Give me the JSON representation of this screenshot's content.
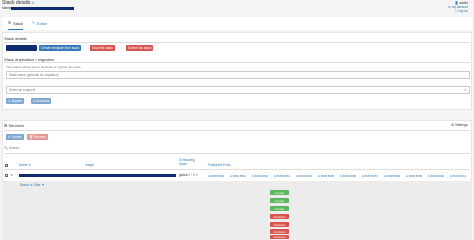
{
  "header": {
    "title": "Stack details",
    "name_label": "Name:",
    "user": "admin",
    "links": [
      "my account",
      "log out"
    ]
  },
  "tabs": [
    {
      "label": "Stack",
      "icon": "list-icon",
      "active": true
    },
    {
      "label": "Editor",
      "icon": "edit-icon",
      "active": false
    }
  ],
  "stack_details": {
    "heading": "Stack details",
    "buttons": {
      "create_template": "Create template from stack",
      "stop": "Stop this stack",
      "delete": "Delete this stack"
    }
  },
  "duplication": {
    "heading": "Stack duplication / migration",
    "description": "This feature allows you to duplicate or migrate this stack.",
    "name_placeholder": "Stack name (optional for migration)",
    "endpoint_placeholder": "Select an endpoint",
    "migrate_label": "Migrate",
    "duplicate_label": "Duplicate"
  },
  "services": {
    "heading": "Services",
    "settings_label": "Settings",
    "update_label": "Update",
    "remove_label": "Remove",
    "search_placeholder": "Search...",
    "columns": {
      "name": "Name",
      "image": "Image",
      "scheduling": "Scheduling Mode",
      "ports": "Published Ports"
    },
    "row": {
      "mode": "global",
      "count": "3 / 5",
      "ports": [
        "8080:8080",
        "8081:8081",
        "8082:8082",
        "8083:8083",
        "8084:8084",
        "8085:8085",
        "8086:8086",
        "8087:8087",
        "8088:8088",
        "8089:8089",
        "8090:8090",
        "8091:8091"
      ]
    },
    "tasks": {
      "status_label": "Status",
      "filter_label": "Filter",
      "statuses": [
        "running",
        "running",
        "running",
        "shutdown",
        "shutdown",
        "shutdown",
        "shutdown"
      ]
    }
  },
  "colors": {
    "primary": "#337ab7",
    "danger": "#d9534f",
    "success": "#5cb85c",
    "name_bar": "#0d2c6b"
  }
}
